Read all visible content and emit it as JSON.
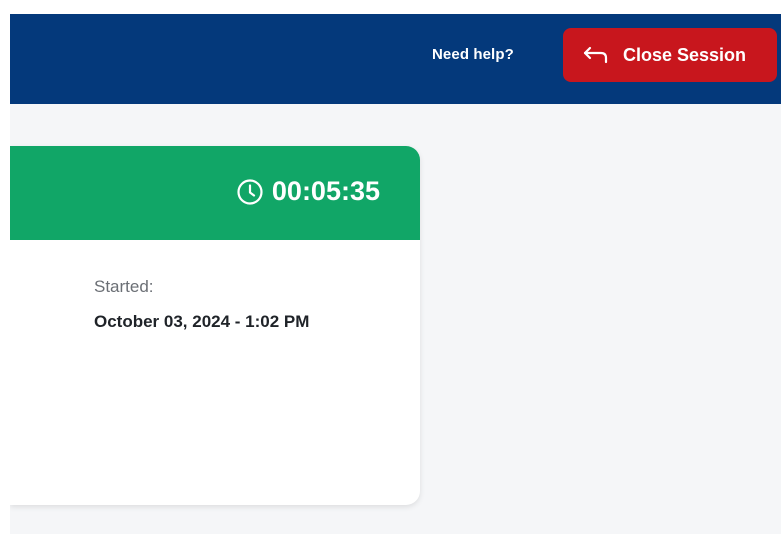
{
  "header": {
    "help_link": "Need help?",
    "close_button": {
      "label": "Close Session",
      "icon": "arrow-back-icon"
    }
  },
  "session": {
    "timer": "00:05:35",
    "timer_icon": "clock-icon",
    "started_label": "Started:",
    "started_value": "October 03, 2024 - 1:02 PM"
  },
  "colors": {
    "header_bg": "#04397b",
    "close_button_bg": "#c8161d",
    "card_header_bg": "#11a667",
    "page_bg": "#f5f6f8"
  }
}
